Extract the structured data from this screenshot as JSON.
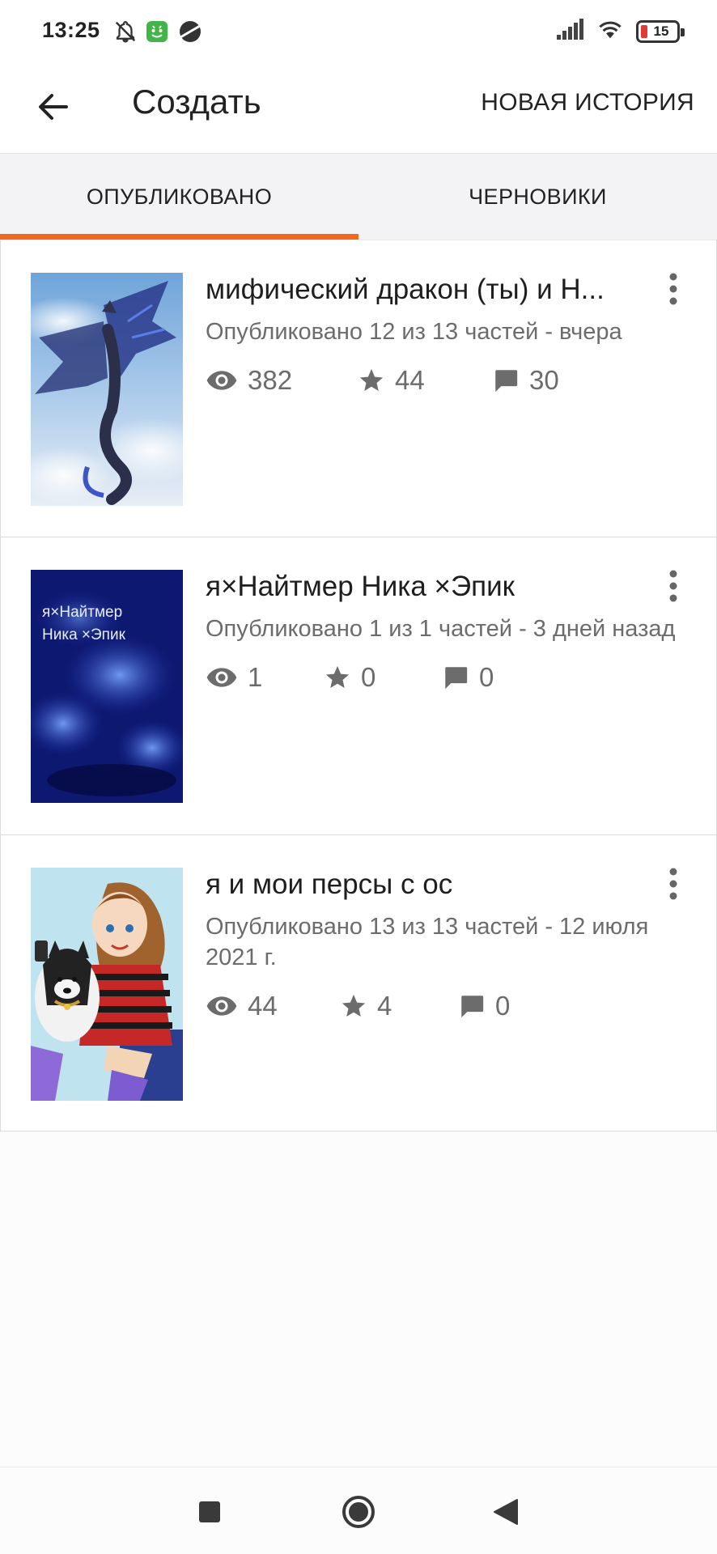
{
  "status_bar": {
    "time": "13:25",
    "battery": "15",
    "icons": [
      "bell-off-icon",
      "android-face-icon",
      "planet-icon",
      "signal-icon",
      "wifi-icon",
      "battery-icon"
    ]
  },
  "app_bar": {
    "title": "Создать",
    "action": "НОВАЯ ИСТОРИЯ"
  },
  "tabs": [
    {
      "label": "ОПУБЛИКОВАНО",
      "selected": true
    },
    {
      "label": "ЧЕРНОВИКИ",
      "selected": false
    }
  ],
  "accent_color": "#f1691f",
  "stories": [
    {
      "title": "мифический дракон (ты) и Н...",
      "meta": "Опубликовано 12 из 13 частей - вчера",
      "views": "382",
      "votes": "44",
      "comments": "30"
    },
    {
      "title": "я×Найтмер Ника ×Эпик",
      "meta": "Опубликовано 1 из 1 частей - 3 дней назад",
      "views": "1",
      "votes": "0",
      "comments": "0",
      "cover_text": "я×Найтмер Ника ×Эпик"
    },
    {
      "title": "я и мои персы с ос",
      "meta": "Опубликовано 13 из 13 частей - 12 июля 2021 г.",
      "views": "44",
      "votes": "4",
      "comments": "0"
    }
  ]
}
